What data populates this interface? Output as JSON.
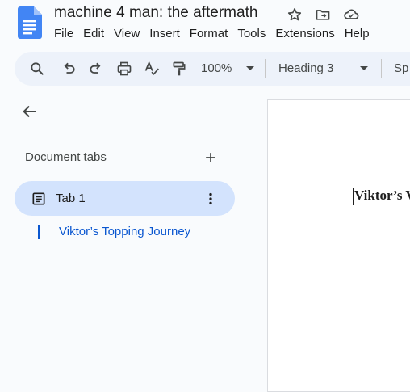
{
  "document": {
    "title": "machine 4 man: the aftermath"
  },
  "menu": [
    "File",
    "Edit",
    "View",
    "Insert",
    "Format",
    "Tools",
    "Extensions",
    "Help"
  ],
  "toolbar": {
    "zoom": "100%",
    "style": "Heading 3",
    "font": "Sp"
  },
  "sidebar": {
    "heading": "Document tabs",
    "tab": {
      "label": "Tab 1"
    },
    "outline": [
      "Viktor’s Topping Journey"
    ]
  },
  "page": {
    "heading_visible": "Viktor’s V"
  },
  "colors": {
    "accent": "#0b57d0",
    "selected_tab_bg": "#d3e3fd",
    "toolbar_bg": "#edf2fa",
    "app_bg": "#f9fbfd"
  },
  "icons": [
    "docs-logo-icon",
    "star-icon",
    "move-to-folder-icon",
    "cloud-status-icon",
    "search-icon",
    "undo-icon",
    "redo-icon",
    "print-icon",
    "spellcheck-icon",
    "paint-format-icon",
    "back-arrow-icon",
    "add-icon",
    "document-icon",
    "more-vert-icon"
  ]
}
